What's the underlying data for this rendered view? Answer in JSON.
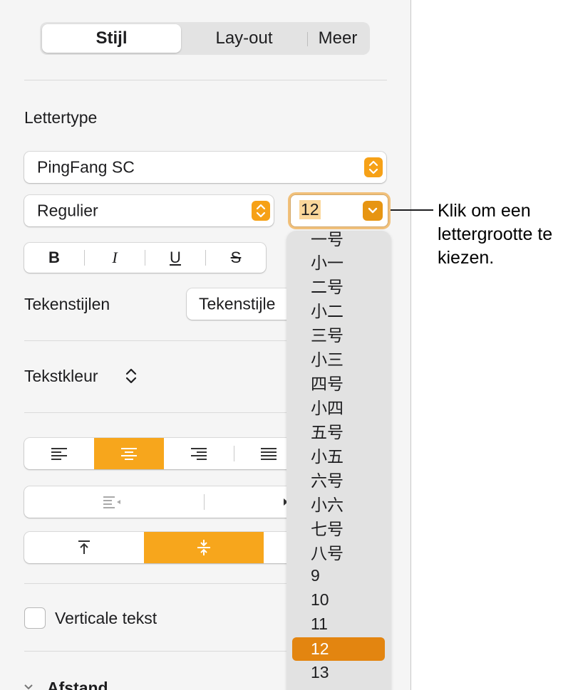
{
  "tabs": [
    {
      "label": "Stijl",
      "active": true
    },
    {
      "label": "Lay-out",
      "active": false
    },
    {
      "label": "Meer",
      "active": false
    }
  ],
  "font_section": {
    "title": "Lettertype",
    "family": "PingFang SC",
    "style": "Regulier",
    "size": "12",
    "format_buttons": [
      "B",
      "I",
      "U",
      "S"
    ]
  },
  "character_styles": {
    "label": "Tekenstijlen",
    "button": "Tekenstijle"
  },
  "text_color": {
    "label": "Tekstkleur"
  },
  "vertical_text": {
    "label": "Verticale tekst",
    "checked": false
  },
  "spacing": {
    "label": "Afstand"
  },
  "size_menu": {
    "items": [
      "一号",
      "小一",
      "二号",
      "小二",
      "三号",
      "小三",
      "四号",
      "小四",
      "五号",
      "小五",
      "六号",
      "小六",
      "七号",
      "八号",
      "9",
      "10",
      "11",
      "12",
      "13"
    ],
    "selected": "12"
  },
  "callout": {
    "text": "Klik om een lettergrootte te kiezen."
  },
  "colors": {
    "accent": "#f7a61c",
    "selected": "#e38510"
  }
}
